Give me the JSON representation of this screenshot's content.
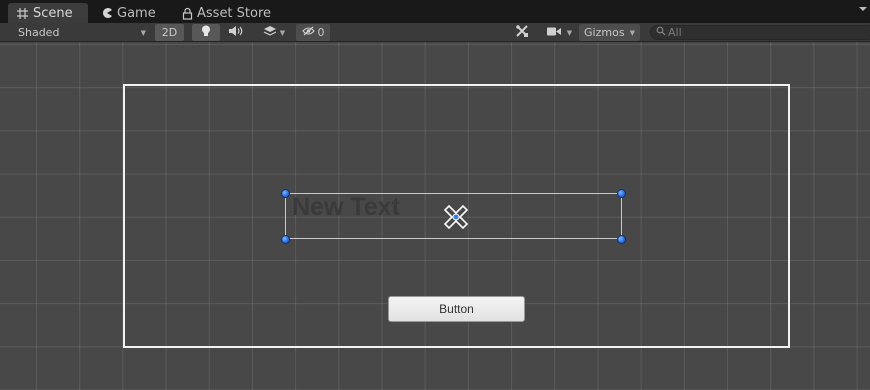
{
  "tabs": [
    {
      "label": "Scene",
      "icon": "grid-icon",
      "active": true
    },
    {
      "label": "Game",
      "icon": "pacman-icon",
      "active": false
    },
    {
      "label": "Asset Store",
      "icon": "lock-icon",
      "active": false
    }
  ],
  "toolbar": {
    "shading_mode": "Shaded",
    "mode_2d_label": "2D",
    "hidden_count": "0",
    "gizmos_label": "Gizmos",
    "search_placeholder": "All"
  },
  "scene": {
    "text_object": "New Text",
    "button_label": "Button"
  },
  "colors": {
    "scene_bg": "#484848",
    "handle_blue": "#2a6ee0",
    "canvas_border": "#f2f2f2"
  }
}
